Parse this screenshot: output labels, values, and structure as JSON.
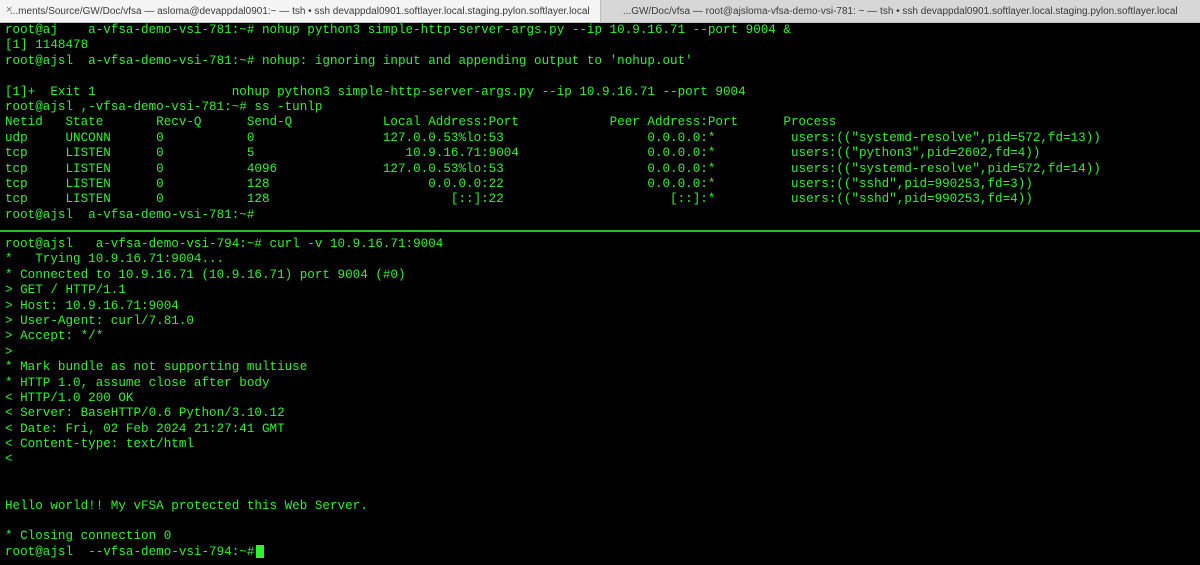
{
  "tabs": [
    {
      "label": "...ments/Source/GW/Doc/vfsa — asloma@devappdal0901:~ — tsh • ssh devappdal0901.softlayer.local.staging.pylon.softlayer.local",
      "close": "×"
    },
    {
      "label": "...GW/Doc/vfsa — root@ajsloma-vfsa-demo-vsi-781: ~ — tsh • ssh devappdal0901.softlayer.local.staging.pylon.softlayer.local"
    }
  ],
  "top_pane": {
    "lines": [
      "root@aj    a-vfsa-demo-vsi-781:~# nohup python3 simple-http-server-args.py --ip 10.9.16.71 --port 9004 &",
      "[1] 1148478",
      "root@ajsl  a-vfsa-demo-vsi-781:~# nohup: ignoring input and appending output to 'nohup.out'",
      "",
      "[1]+  Exit 1                  nohup python3 simple-http-server-args.py --ip 10.9.16.71 --port 9004",
      "root@ajsl ,-vfsa-demo-vsi-781:~# ss -tunlp",
      "Netid   State       Recv-Q      Send-Q            Local Address:Port            Peer Address:Port      Process",
      "udp     UNCONN      0           0                 127.0.0.53%lo:53                   0.0.0.0:*          users:((\"systemd-resolve\",pid=572,fd=13))",
      "tcp     LISTEN      0           5                    10.9.16.71:9004                 0.0.0.0:*          users:((\"python3\",pid=2602,fd=4))",
      "tcp     LISTEN      0           4096              127.0.0.53%lo:53                   0.0.0.0:*          users:((\"systemd-resolve\",pid=572,fd=14))",
      "tcp     LISTEN      0           128                     0.0.0.0:22                   0.0.0.0:*          users:((\"sshd\",pid=990253,fd=3))",
      "tcp     LISTEN      0           128                        [::]:22                      [::]:*          users:((\"sshd\",pid=990253,fd=4))",
      "root@ajsl  a-vfsa-demo-vsi-781:~#"
    ]
  },
  "bottom_pane": {
    "lines": [
      "root@ajsl   a-vfsa-demo-vsi-794:~# curl -v 10.9.16.71:9004",
      "*   Trying 10.9.16.71:9004...",
      "* Connected to 10.9.16.71 (10.9.16.71) port 9004 (#0)",
      "> GET / HTTP/1.1",
      "> Host: 10.9.16.71:9004",
      "> User-Agent: curl/7.81.0",
      "> Accept: */*",
      ">",
      "* Mark bundle as not supporting multiuse",
      "* HTTP 1.0, assume close after body",
      "< HTTP/1.0 200 OK",
      "< Server: BaseHTTP/0.6 Python/3.10.12",
      "< Date: Fri, 02 Feb 2024 21:27:41 GMT",
      "< Content-type: text/html",
      "<",
      "",
      "",
      "Hello world!! My vFSA protected this Web Server.",
      "",
      "* Closing connection 0",
      "root@ajsl  --vfsa-demo-vsi-794:~#"
    ]
  },
  "colors": {
    "terminal_bg": "#000000",
    "terminal_fg": "#2df52d",
    "divider": "#1fbf2f"
  }
}
